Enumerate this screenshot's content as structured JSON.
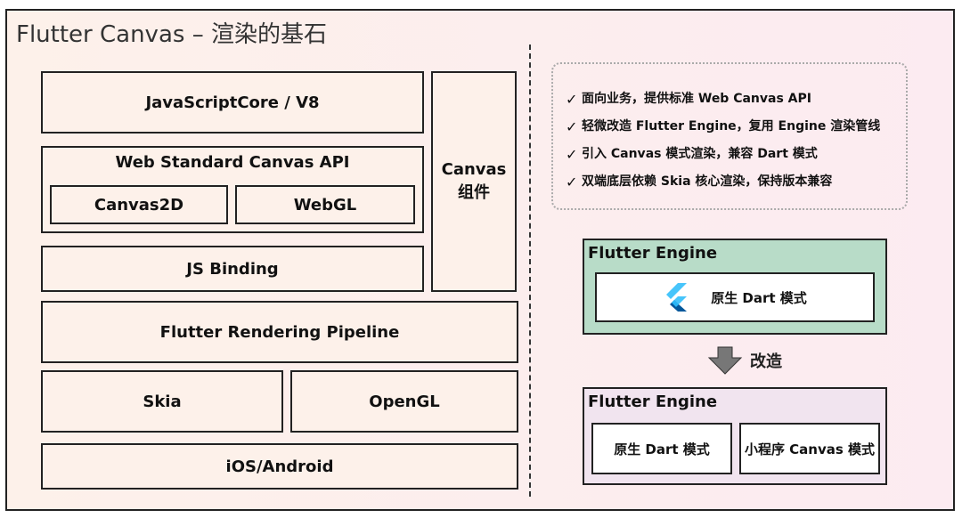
{
  "title": "Flutter Canvas – 渲染的基石",
  "stack": {
    "jscore": "JavaScriptCore / V8",
    "web_api": "Web Standard Canvas API",
    "canvas2d": "Canvas2D",
    "webgl": "WebGL",
    "js_binding": "JS Binding",
    "canvas_component_line1": "Canvas",
    "canvas_component_line2": "组件",
    "pipeline": "Flutter Rendering Pipeline",
    "skia": "Skia",
    "opengl": "OpenGL",
    "platform": "iOS/Android"
  },
  "notes": [
    "面向业务，提供标准 Web Canvas API",
    "轻微改造 Flutter Engine，复用 Engine 渲染管线",
    "引入 Canvas 模式渲染，兼容 Dart 模式",
    "双端底层依赖 Skia 核心渲染，保持版本兼容"
  ],
  "engine_before": {
    "title": "Flutter Engine",
    "mode": "原生 Dart 模式",
    "color": "#b8dcc8"
  },
  "transform_label": "改造",
  "engine_after": {
    "title": "Flutter Engine",
    "mode_dart": "原生 Dart 模式",
    "mode_canvas": "小程序 Canvas 模式",
    "color": "#f1e4ef"
  },
  "icons": {
    "check": "check-icon",
    "flutter": "flutter-logo-icon",
    "arrow": "down-arrow-icon"
  }
}
